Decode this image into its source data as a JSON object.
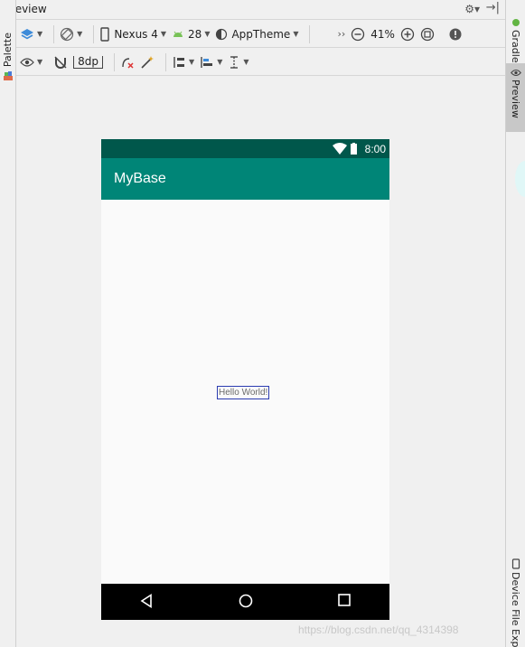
{
  "panel": {
    "title": "Preview"
  },
  "left_strip": {
    "palette_label": "Palette"
  },
  "right_strip": {
    "gradle_label": "Gradle",
    "preview_label": "Preview",
    "device_file_label": "Device File Expl"
  },
  "toolbar1": {
    "device": "Nexus 4",
    "api": "28",
    "theme": "AppTheme",
    "more": "››",
    "zoom": "41%"
  },
  "toolbar2": {
    "margin": "8dp"
  },
  "device_screen": {
    "time": "8:00",
    "app_title": "MyBase",
    "hello_text": "Hello World!",
    "statusbar_color": "#00574b",
    "appbar_color": "#008577"
  },
  "watermark": "https://blog.csdn.net/qq_4314398"
}
